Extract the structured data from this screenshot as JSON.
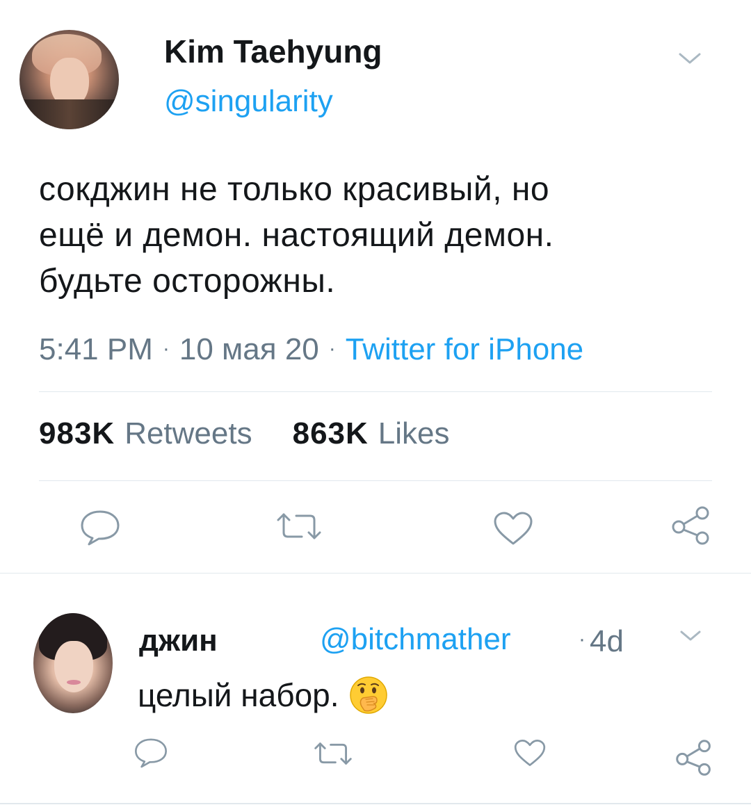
{
  "tweet": {
    "author_name": "Kim Taehyung",
    "author_handle": "@singularity",
    "text_lines": [
      "сокджин не только красивый, но",
      "ещё и демон. настоящий демон.",
      "будьте осторожны."
    ],
    "time": "5:41 PM",
    "date": "10 мая 20",
    "separator": "·",
    "client": "Twitter for iPhone",
    "retweets_count": "983K",
    "retweets_label": "Retweets",
    "likes_count": "863K",
    "likes_label": "Likes",
    "actions": [
      "reply-icon",
      "retweet-icon",
      "like-icon",
      "share-icon"
    ]
  },
  "reply": {
    "author_name": "джин",
    "author_handle": "@bitchmather",
    "separator": "·",
    "age": "4d",
    "text": "целый набор.",
    "emoji": "face-with-hand-over-mouth",
    "actions": [
      "reply-icon",
      "retweet-icon",
      "like-icon",
      "share-icon"
    ]
  },
  "colors": {
    "accent": "#1da1f2",
    "muted": "#657786",
    "text": "#14171a",
    "divider": "#e1e8ed"
  }
}
